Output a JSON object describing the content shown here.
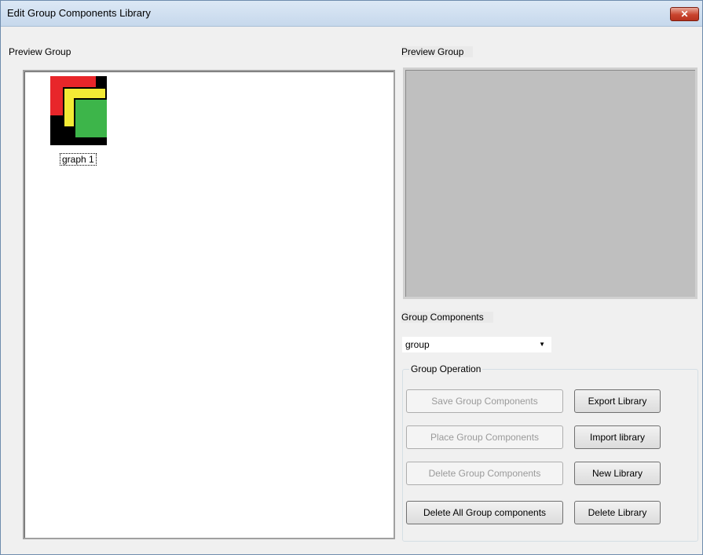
{
  "window": {
    "title": "Edit Group Components Library",
    "close_symbol": "✕"
  },
  "left_panel": {
    "label": "Preview Group",
    "items": [
      {
        "label": "graph 1",
        "icon": "graph-thumbnail-icon"
      }
    ]
  },
  "right_panel": {
    "label": "Preview Group"
  },
  "group_components": {
    "label": "Group Components",
    "selected": "group",
    "arrow": "▼"
  },
  "group_operation": {
    "legend": "Group Operation",
    "buttons_left": [
      {
        "label": "Save Group Components",
        "enabled": false
      },
      {
        "label": "Place Group Components",
        "enabled": false
      },
      {
        "label": "Delete Group Components",
        "enabled": false
      },
      {
        "label": "Delete All Group components",
        "enabled": true
      }
    ],
    "buttons_right": [
      {
        "label": "Export Library",
        "enabled": true
      },
      {
        "label": "Import library",
        "enabled": true
      },
      {
        "label": "New Library",
        "enabled": true
      },
      {
        "label": "Delete Library",
        "enabled": true
      }
    ]
  },
  "colors": {
    "thumb_red": "#e8262a",
    "thumb_yellow": "#f3ea35",
    "thumb_green": "#3db54a",
    "preview_bg": "#bfbfbf"
  }
}
